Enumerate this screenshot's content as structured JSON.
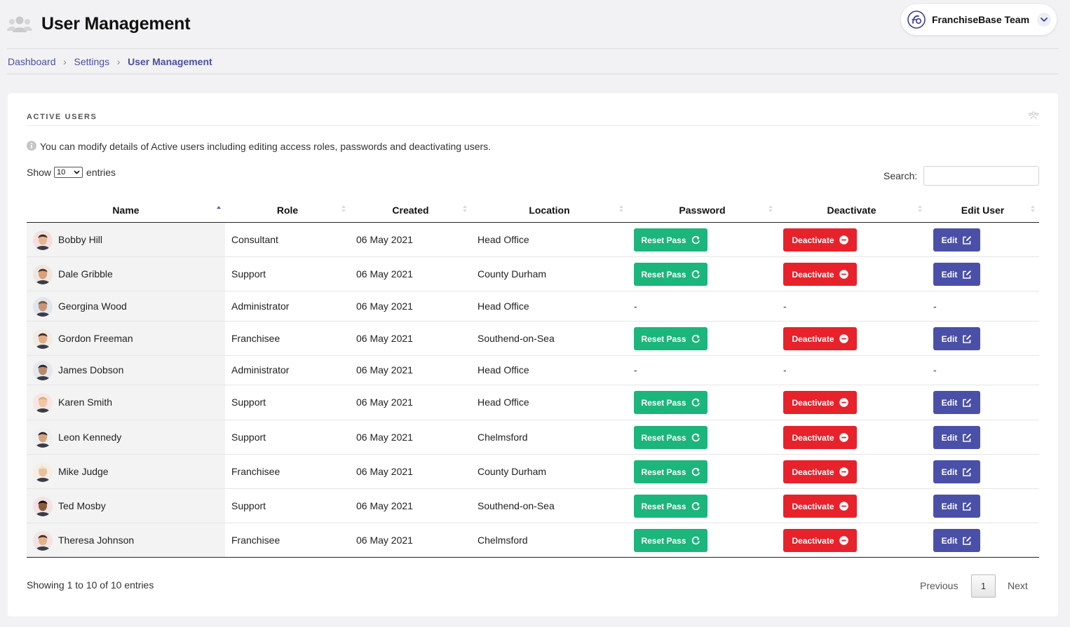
{
  "header": {
    "title": "User Management",
    "team_name": "FranchiseBase Team"
  },
  "breadcrumb": {
    "items": [
      "Dashboard",
      "Settings"
    ],
    "current": "User Management",
    "separator": "›"
  },
  "card": {
    "title": "ACTIVE USERS",
    "info": "You can modify details of Active users including editing access roles, passwords and deactivating users.",
    "show_label": "Show",
    "entries_value": "10",
    "entries_label": "entries",
    "search_label": "Search:",
    "search_value": ""
  },
  "table": {
    "columns": [
      "Name",
      "Role",
      "Created",
      "Location",
      "Password",
      "Deactivate",
      "Edit User"
    ],
    "reset_label": "Reset Pass",
    "deactivate_label": "Deactivate",
    "edit_label": "Edit",
    "no_action": "-",
    "rows": [
      {
        "name": "Bobby Hill",
        "role": "Consultant",
        "created": "06 May 2021",
        "location": "Head Office",
        "actions": true
      },
      {
        "name": "Dale Gribble",
        "role": "Support",
        "created": "06 May 2021",
        "location": "County Durham",
        "actions": true
      },
      {
        "name": "Georgina Wood",
        "role": "Administrator",
        "created": "06 May 2021",
        "location": "Head Office",
        "actions": false
      },
      {
        "name": "Gordon Freeman",
        "role": "Franchisee",
        "created": "06 May 2021",
        "location": "Southend-on-Sea",
        "actions": true
      },
      {
        "name": "James Dobson",
        "role": "Administrator",
        "created": "06 May 2021",
        "location": "Head Office",
        "actions": false
      },
      {
        "name": "Karen Smith",
        "role": "Support",
        "created": "06 May 2021",
        "location": "Head Office",
        "actions": true
      },
      {
        "name": "Leon Kennedy",
        "role": "Support",
        "created": "06 May 2021",
        "location": "Chelmsford",
        "actions": true
      },
      {
        "name": "Mike Judge",
        "role": "Franchisee",
        "created": "06 May 2021",
        "location": "County Durham",
        "actions": true
      },
      {
        "name": "Ted Mosby",
        "role": "Support",
        "created": "06 May 2021",
        "location": "Southend-on-Sea",
        "actions": true
      },
      {
        "name": "Theresa Johnson",
        "role": "Franchisee",
        "created": "06 May 2021",
        "location": "Chelmsford",
        "actions": true
      }
    ]
  },
  "footer": {
    "info": "Showing 1 to 10 of 10 entries",
    "previous": "Previous",
    "current_page": "1",
    "next": "Next"
  },
  "colors": {
    "reset": "#1cb57b",
    "deactivate": "#e7222b",
    "edit": "#4a50a8",
    "link": "#4a4fa0"
  },
  "icons": {
    "header": "users-icon",
    "team_logo": "franchisebase-logo",
    "team_menu": "chevron-down-icon",
    "card": "users-icon",
    "info": "info-icon",
    "reset": "refresh-icon",
    "deactivate": "minus-circle-icon",
    "edit": "edit-icon"
  }
}
